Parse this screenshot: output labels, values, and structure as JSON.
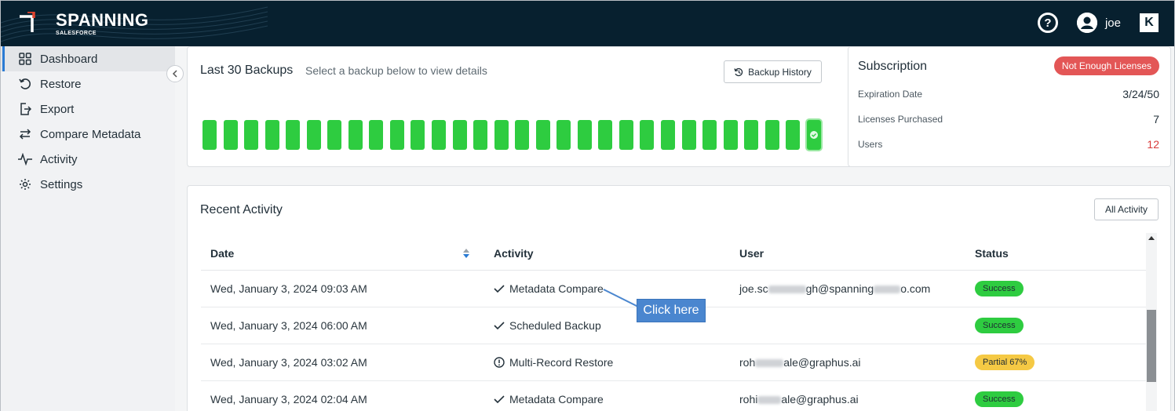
{
  "header": {
    "brand_name": "SPANNING",
    "brand_sub": "SALESFORCE",
    "username": "joe",
    "help_glyph": "?",
    "k_glyph": "K",
    "icons": [
      "help-icon",
      "user-avatar-icon",
      "kaseya-k-icon"
    ],
    "bg_color": "#07202f"
  },
  "sidebar": {
    "items": [
      {
        "label": "Dashboard",
        "icon": "dashboard-grid-icon",
        "active": true
      },
      {
        "label": "Restore",
        "icon": "restore-icon"
      },
      {
        "label": "Export",
        "icon": "export-icon"
      },
      {
        "label": "Compare Metadata",
        "icon": "compare-arrows-icon"
      },
      {
        "label": "Activity",
        "icon": "activity-pulse-icon"
      },
      {
        "label": "Settings",
        "icon": "gear-icon"
      }
    ]
  },
  "backups": {
    "title": "Last 30 Backups",
    "subtitle": "Select a backup below to view details",
    "history_button": "Backup History",
    "count": 30,
    "bar_color": "#2ecc40"
  },
  "subscription": {
    "title": "Subscription",
    "badge": "Not Enough Licenses",
    "rows": [
      {
        "label": "Expiration Date",
        "value": "3/24/50"
      },
      {
        "label": "Licenses Purchased",
        "value": "7"
      },
      {
        "label": "Users",
        "value": "12"
      }
    ]
  },
  "activity": {
    "title": "Recent Activity",
    "all_button": "All Activity",
    "columns": [
      "Date",
      "Activity",
      "User",
      "Status"
    ],
    "rows": [
      {
        "date": "Wed, January 3, 2024 09:03 AM",
        "activity": "Metadata Compare",
        "icon": "check-icon",
        "user_a": "joe.sc",
        "user_b": "gh@spanning",
        "user_c": "o.com",
        "status": "Success",
        "status_type": "success"
      },
      {
        "date": "Wed, January 3, 2024 06:00 AM",
        "activity": "Scheduled Backup",
        "icon": "check-icon",
        "user_a": "",
        "user_b": "",
        "user_c": "",
        "status": "Success",
        "status_type": "success"
      },
      {
        "date": "Wed, January 3, 2024 03:02 AM",
        "activity": "Multi-Record Restore",
        "icon": "warning-circle-icon",
        "user_a": "roh",
        "user_b": "ale@graphus.ai",
        "user_c": "",
        "status": "Partial 67%",
        "status_type": "partial"
      },
      {
        "date": "Wed, January 3, 2024 02:04 AM",
        "activity": "Metadata Compare",
        "icon": "check-icon",
        "user_a": "rohi",
        "user_b": "ale@graphus.ai",
        "user_c": "",
        "status": "Success",
        "status_type": "success"
      }
    ]
  },
  "callout": {
    "label": "Click here"
  }
}
